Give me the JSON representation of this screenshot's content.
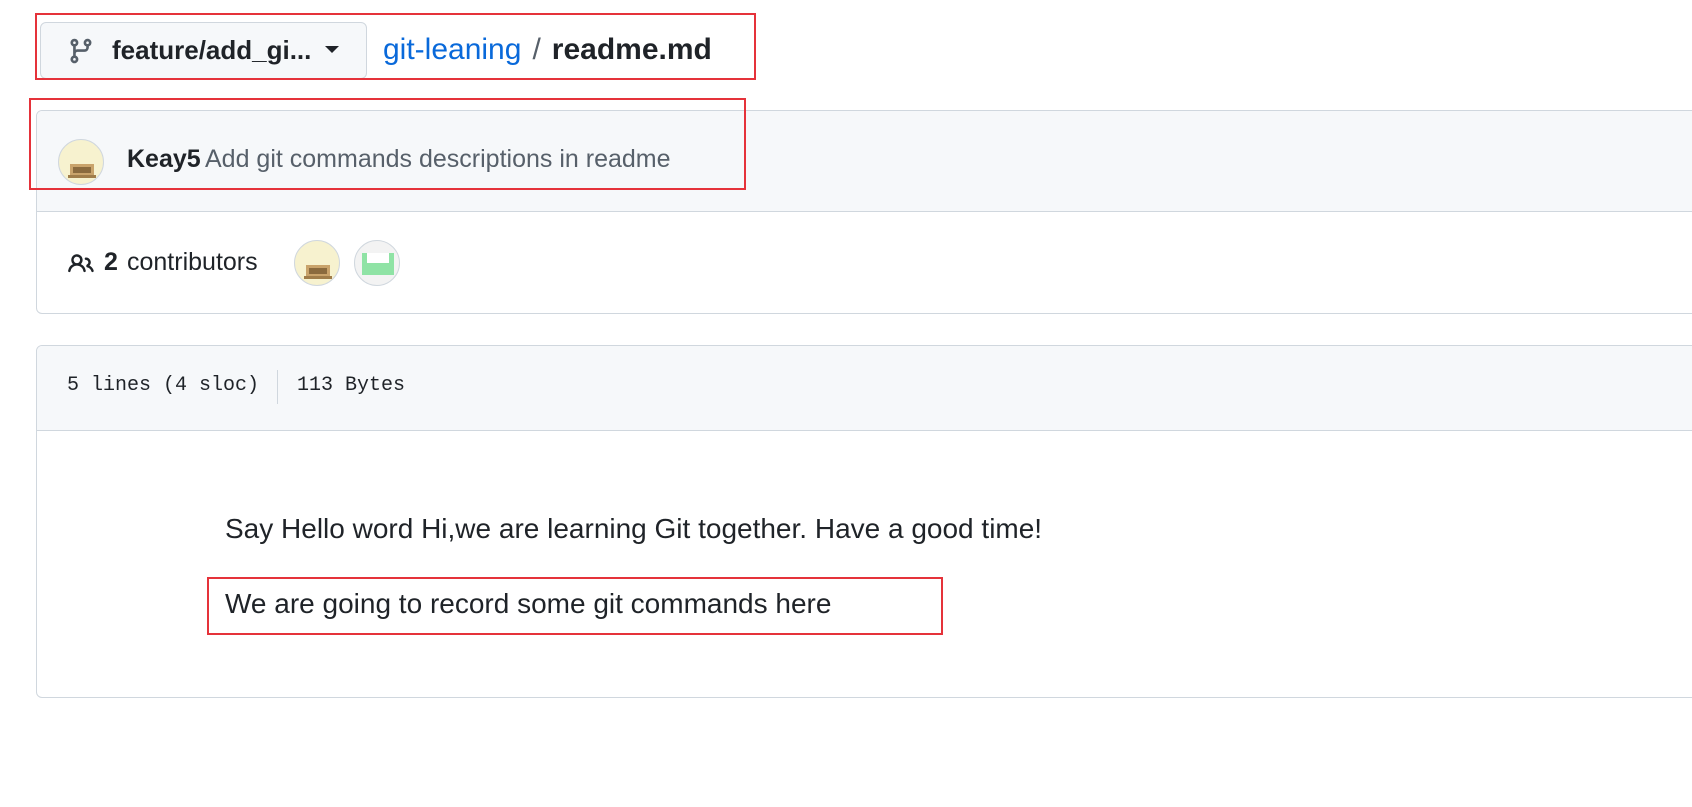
{
  "header": {
    "branch_name": "feature/add_gi...",
    "repo_name": "git-leaning",
    "separator": "/",
    "file_name": "readme.md"
  },
  "commit": {
    "author": "Keay5",
    "message": "Add git commands descriptions in readme"
  },
  "contributors": {
    "count": "2",
    "label": "contributors"
  },
  "file_info": {
    "lines": "5 lines (4 sloc)",
    "size": "113 Bytes"
  },
  "content": {
    "paragraphs": [
      "Say Hello word Hi,we are learning Git together. Have a good time!",
      "We are going to record some git commands here"
    ]
  },
  "colors": {
    "link": "#0969da",
    "annotation": "#e5323a",
    "header_bg": "#f6f8fa",
    "border": "#d0d7de"
  }
}
